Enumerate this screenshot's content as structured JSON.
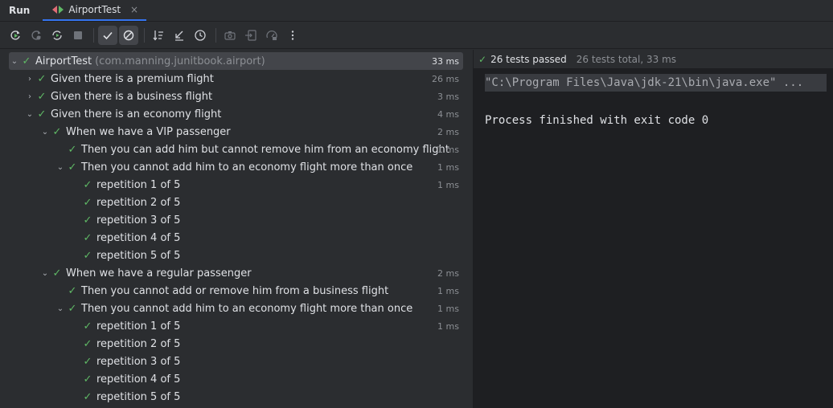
{
  "top": {
    "run_label": "Run",
    "tab_label": "AirportTest",
    "tab_close": "×"
  },
  "toolbar": {
    "buttons": [
      {
        "icon": "rerun-icon"
      },
      {
        "icon": "rerun-failed-icon"
      },
      {
        "icon": "toggle-auto-test-icon"
      },
      {
        "icon": "stop-icon"
      },
      {
        "icon": "show-passed-icon",
        "active": true
      },
      {
        "icon": "show-ignored-icon",
        "active": true
      },
      {
        "icon": "sort-alphabetically-icon"
      },
      {
        "icon": "sort-by-duration-icon"
      },
      {
        "icon": "test-history-icon"
      },
      {
        "icon": "screenshot-icon"
      },
      {
        "icon": "import-tests-icon"
      },
      {
        "icon": "coverage-icon"
      },
      {
        "icon": "more-options-icon"
      }
    ]
  },
  "tree": {
    "rows": [
      {
        "chev": "⌄",
        "label": "AirportTest",
        "pkg": "(com.manning.junitbook.airport)",
        "duration": "33 ms"
      },
      {
        "chev": "›",
        "label": "Given there is a premium flight",
        "duration": "26 ms"
      },
      {
        "chev": "›",
        "label": "Given there is a business flight",
        "duration": "3 ms"
      },
      {
        "chev": "⌄",
        "label": "Given there is an economy flight",
        "duration": "4 ms"
      },
      {
        "chev": "⌄",
        "label": "When we have a VIP passenger",
        "duration": "2 ms"
      },
      {
        "chev": "",
        "label": "Then you can add him but cannot remove him from an economy flight",
        "duration": "1 ms"
      },
      {
        "chev": "⌄",
        "label": "Then you cannot add him to an economy flight more than once",
        "duration": "1 ms"
      },
      {
        "chev": "",
        "label": "repetition 1 of 5",
        "duration": "1 ms"
      },
      {
        "chev": "",
        "label": "repetition 2 of 5",
        "duration": ""
      },
      {
        "chev": "",
        "label": "repetition 3 of 5",
        "duration": ""
      },
      {
        "chev": "",
        "label": "repetition 4 of 5",
        "duration": ""
      },
      {
        "chev": "",
        "label": "repetition 5 of 5",
        "duration": ""
      },
      {
        "chev": "⌄",
        "label": "When we have a regular passenger",
        "duration": "2 ms"
      },
      {
        "chev": "",
        "label": "Then you cannot add or remove him from a business flight",
        "duration": "1 ms"
      },
      {
        "chev": "⌄",
        "label": "Then you cannot add him to an economy flight more than once",
        "duration": "1 ms"
      },
      {
        "chev": "",
        "label": "repetition 1 of 5",
        "duration": "1 ms"
      },
      {
        "chev": "",
        "label": "repetition 2 of 5",
        "duration": ""
      },
      {
        "chev": "",
        "label": "repetition 3 of 5",
        "duration": ""
      },
      {
        "chev": "",
        "label": "repetition 4 of 5",
        "duration": ""
      },
      {
        "chev": "",
        "label": "repetition 5 of 5",
        "duration": ""
      }
    ]
  },
  "console": {
    "status_passed": "26 tests passed",
    "status_total": "26 tests total, 33 ms",
    "command_line": "\"C:\\Program Files\\Java\\jdk-21\\bin\\java.exe\" ...",
    "exit_line": "Process finished with exit code 0"
  },
  "colors": {
    "pass_green": "#5fb865",
    "accent": "#3574f0"
  }
}
